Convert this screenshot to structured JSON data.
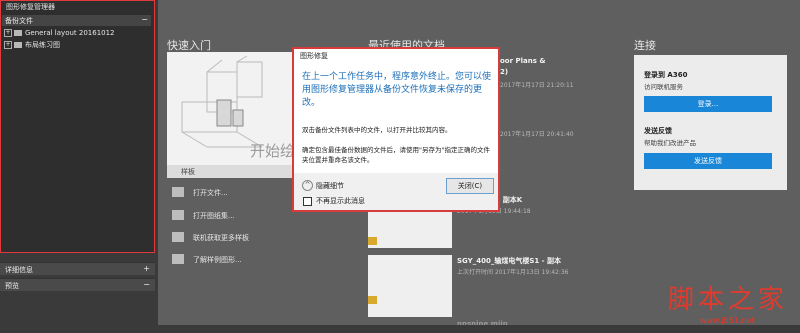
{
  "left_panel": {
    "title": "图形修复管理器",
    "backup_section": {
      "label": "备份文件",
      "toggle": "−"
    },
    "tree": [
      {
        "label": "General layout 20161012"
      },
      {
        "label": "布局练习图"
      }
    ],
    "details_section": {
      "label": "详细信息",
      "toggle": "+"
    },
    "preview_section": {
      "label": "预览",
      "toggle": "−"
    }
  },
  "quick_start": {
    "title": "快速入门",
    "start_drawing": "开始绘",
    "template_label": "样板",
    "links": [
      {
        "label": "打开文件..."
      },
      {
        "label": "打开图纸集..."
      },
      {
        "label": "联机获取更多样板"
      },
      {
        "label": "了解样例图形..."
      }
    ]
  },
  "recent": {
    "title": "最近使用的文档",
    "docs": [
      {
        "name": "oor Plans &",
        "line2": "2)",
        "date": "2017年1月17日 21:20:11"
      },
      {
        "name": "",
        "line2": "",
        "date": "2017年1月17日 20:41:40"
      },
      {
        "name": "煤电气楼S1 - 副本K",
        "line2": "",
        "date": "2017年1月13日 19:44:18"
      },
      {
        "name": "SGY_400_输煤电气楼S1 - 副本",
        "line2": "",
        "date": "上次打开时间 2017年1月13日 19:42:36"
      },
      {
        "name": "nnsnine miin",
        "line2": "",
        "date": ""
      }
    ]
  },
  "connect": {
    "title": "连接",
    "a360_title": "登录到 A360",
    "a360_sub": "访问联机服务",
    "login_button": "登录...",
    "feedback_title": "发送反馈",
    "feedback_sub": "帮助我们改进产品",
    "feedback_button": "发送反馈"
  },
  "dialog": {
    "title": "图形修复",
    "main_message": "在上一个工作任务中，程序意外终止。您可以使用图形修复管理器从备份文件恢复未保存的更改。",
    "text1": "双击备份文件列表中的文件，以打开并比较其内容。",
    "text2": "确定包含最佳备份数据的文件后，请使用\"另存为\"指定正确的文件夹位置并重命名该文件。",
    "hide_details": "隐藏细节",
    "close_button": "关闭(C)",
    "no_show": "不再显示此消息"
  },
  "watermark": {
    "text": "脚本之家",
    "url": "www.jb51.net"
  },
  "colors": {
    "accent_red": "#d83b3b",
    "button_blue": "#1a86d8",
    "dialog_text_blue": "#1c6fb8"
  }
}
